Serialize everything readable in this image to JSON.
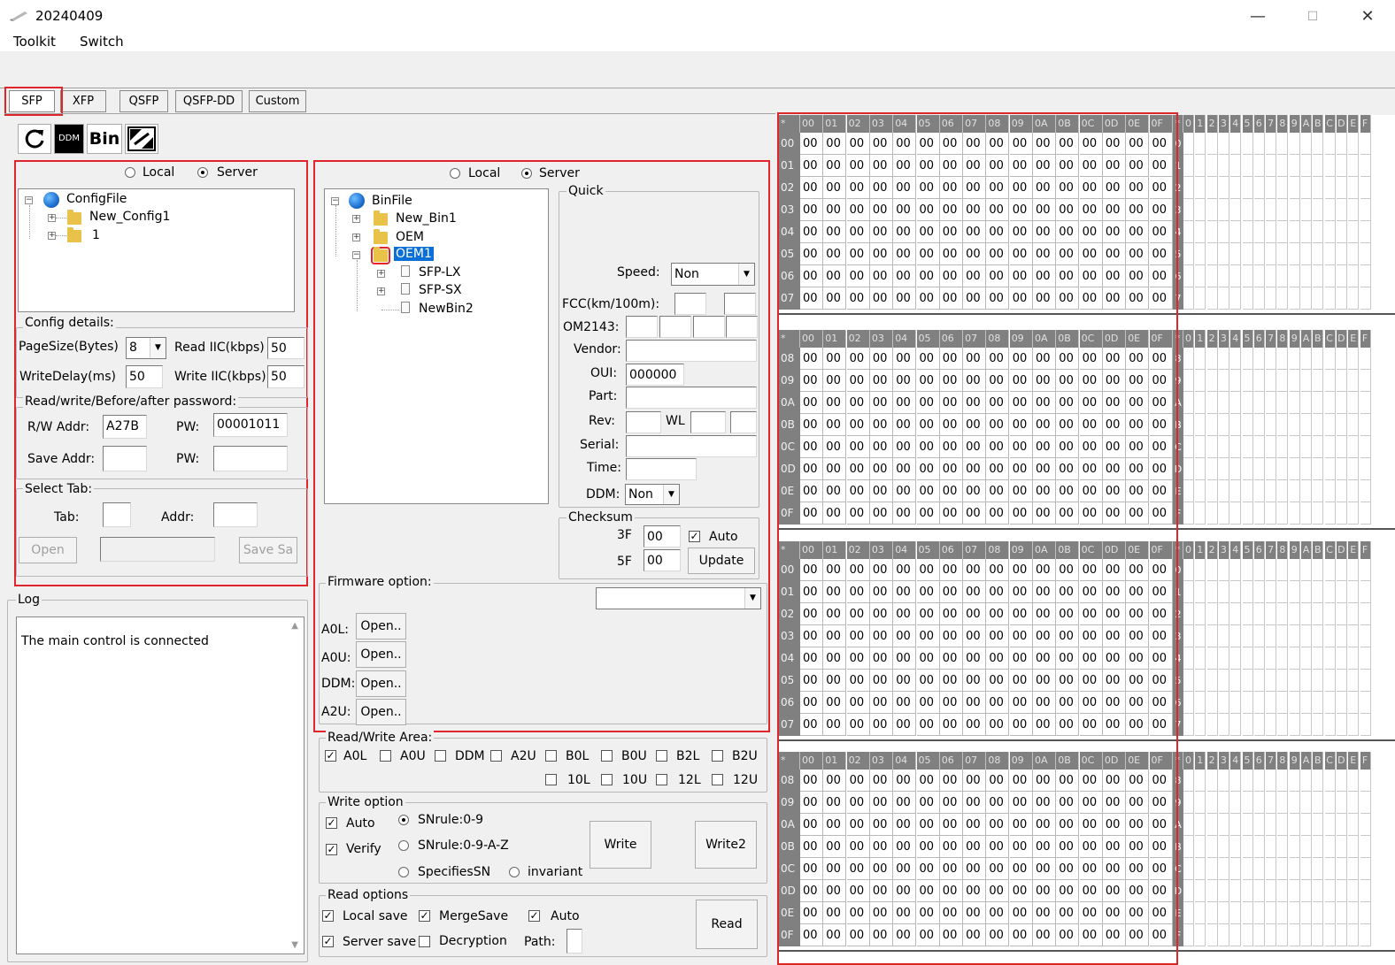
{
  "window": {
    "title": "20240409",
    "minimize": "—",
    "maximize": "☐",
    "close": "✕"
  },
  "menu": [
    "Toolkit",
    "Switch"
  ],
  "tabs": [
    "SFP",
    "XFP",
    "QSFP",
    "QSFP-DD",
    "Custom"
  ],
  "toolbar": {
    "refresh_icon": "refresh-icon",
    "ddm": "DDM",
    "bin": "Bin",
    "tool_icon": "swap-icon"
  },
  "config": {
    "source_local": "Local",
    "source_server": "Server",
    "selected": "Server",
    "tree": {
      "root": "ConfigFile",
      "children": [
        "New_Config1",
        "1"
      ]
    },
    "details_label": "Config details:",
    "pagesize_label": "PageSize(Bytes)",
    "pagesize_value": "8",
    "read_iic_label": "Read IIC(kbps)",
    "read_iic_value": "50",
    "writedelay_label": "WriteDelay(ms)",
    "writedelay_value": "50",
    "write_iic_label": "Write IIC(kbps)",
    "write_iic_value": "50",
    "password_label": "Read/write/Before/after password:",
    "rw_addr_label": "R/W Addr:",
    "rw_addr_value": "A27B",
    "pw_label": "PW:",
    "pw_value": "00001011",
    "save_addr_label": "Save Addr:",
    "save_addr_value": "",
    "pw2_label": "PW:",
    "pw2_value": "",
    "select_tab_label": "Select Tab:",
    "tab_label": "Tab:",
    "tab_value": "",
    "addr_label": "Addr:",
    "addr_value": "",
    "open_button": "Open",
    "path_value": "",
    "save_button": "Save Sa"
  },
  "log": {
    "label": "Log",
    "message": "The main control is connected"
  },
  "bin": {
    "source_local": "Local",
    "source_server": "Server",
    "tree": {
      "root": "BinFile",
      "folders": [
        "New_Bin1",
        "OEM",
        "OEM1"
      ],
      "selected": "OEM1",
      "files": [
        "SFP-LX",
        "SFP-SX",
        "NewBin2"
      ]
    }
  },
  "quick": {
    "label": "Quick",
    "speed_label": "Speed:",
    "speed_value": "Non",
    "fcc_label": "FCC(km/100m):",
    "om_label": "OM2143:",
    "vendor_label": "Vendor:",
    "vendor_value": "",
    "oui_label": "OUI:",
    "oui_value": "000000",
    "part_label": "Part:",
    "part_value": "",
    "rev_label": "Rev:",
    "wl_label": "WL",
    "serial_label": "Serial:",
    "serial_value": "",
    "time_label": "Time:",
    "time_value": "",
    "ddm_label": "DDM:",
    "ddm_value": "Non"
  },
  "checksum": {
    "label": "Checksum",
    "row1_label": "3F",
    "row1_value": "00",
    "auto_label": "Auto",
    "row2_label": "5F",
    "row2_value": "00",
    "update_button": "Update"
  },
  "firmware": {
    "label": "Firmware option:",
    "rows": [
      {
        "label": "A0L:",
        "button": "Open.."
      },
      {
        "label": "A0U:",
        "button": "Open.."
      },
      {
        "label": "DDM:",
        "button": "Open.."
      },
      {
        "label": "A2U:",
        "button": "Open.."
      }
    ]
  },
  "rw_area": {
    "label": "Read/Write Area:",
    "items": [
      {
        "label": "A0L",
        "checked": true
      },
      {
        "label": "A0U",
        "checked": false
      },
      {
        "label": "DDM",
        "checked": false
      },
      {
        "label": "A2U",
        "checked": false
      },
      {
        "label": "B0L",
        "checked": false
      },
      {
        "label": "B0U",
        "checked": false
      },
      {
        "label": "B2L",
        "checked": false
      },
      {
        "label": "B2U",
        "checked": false
      },
      {
        "label": "10L",
        "checked": false
      },
      {
        "label": "10U",
        "checked": false
      },
      {
        "label": "12L",
        "checked": false
      },
      {
        "label": "12U",
        "checked": false
      }
    ]
  },
  "write_option": {
    "label": "Write option",
    "auto_label": "Auto",
    "verify_label": "Verify",
    "sn1": "SNrule:0-9",
    "sn2": "SNrule:0-9-A-Z",
    "sn3": "SpecifiesSN",
    "sn4": "invariant",
    "write_button": "Write",
    "write2_button": "Write2"
  },
  "read_options": {
    "label": "Read options",
    "local_save": "Local save",
    "merge_save": "MergeSave",
    "auto": "Auto",
    "server_save": "Server save",
    "decryption": "Decryption",
    "path_label": "Path:",
    "read_button": "Read"
  },
  "hex": {
    "corner": "*",
    "cols": [
      "00",
      "01",
      "02",
      "03",
      "04",
      "05",
      "06",
      "07",
      "08",
      "09",
      "0A",
      "0B",
      "0C",
      "0D",
      "0E",
      "0F"
    ],
    "ascii_cols": [
      "0",
      "1",
      "2",
      "3",
      "4",
      "5",
      "6",
      "7",
      "8",
      "9",
      "A",
      "B",
      "C",
      "D",
      "E",
      "F"
    ],
    "blocks": [
      {
        "rows": [
          "00",
          "01",
          "02",
          "03",
          "04",
          "05",
          "06",
          "07"
        ]
      },
      {
        "rows": [
          "08",
          "09",
          "0A",
          "0B",
          "0C",
          "0D",
          "0E",
          "0F"
        ]
      },
      {
        "rows": [
          "00",
          "01",
          "02",
          "03",
          "04",
          "05",
          "06",
          "07"
        ]
      },
      {
        "rows": [
          "08",
          "09",
          "0A",
          "0B",
          "0C",
          "0D",
          "0E",
          "0F"
        ]
      }
    ],
    "cell_value": "00",
    "ascii_row_labels": [
      "0",
      "1",
      "2",
      "3",
      "4",
      "5",
      "6",
      "7",
      "8",
      "9",
      "A",
      "B",
      "C",
      "D",
      "E",
      "F"
    ]
  }
}
